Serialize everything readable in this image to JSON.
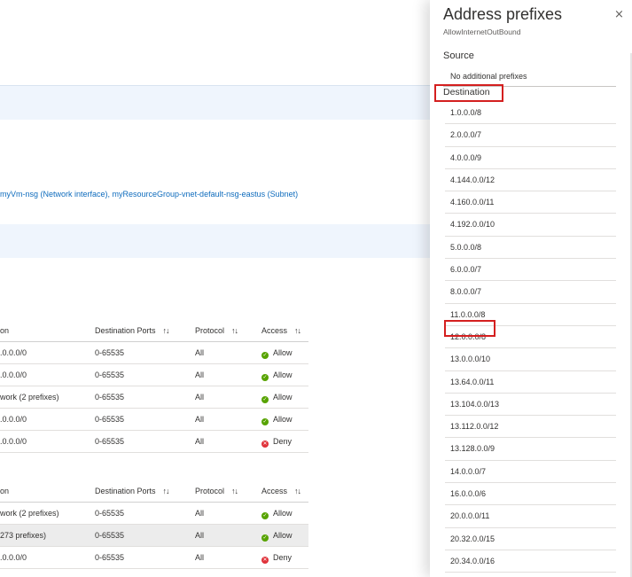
{
  "page": {
    "association_text": "myVm-nsg (Network interface), myResourceGroup-vnet-default-nsg-eastus (Subnet)"
  },
  "table1": {
    "headers": [
      "on",
      "Destination Ports",
      "Protocol",
      "Access"
    ],
    "rows": [
      {
        "dest": ".0.0.0/0",
        "ports": "0-65535",
        "protocol": "All",
        "access": "Allow"
      },
      {
        "dest": ".0.0.0/0",
        "ports": "0-65535",
        "protocol": "All",
        "access": "Allow"
      },
      {
        "dest": "work (2 prefixes)",
        "ports": "0-65535",
        "protocol": "All",
        "access": "Allow"
      },
      {
        "dest": ".0.0.0/0",
        "ports": "0-65535",
        "protocol": "All",
        "access": "Allow"
      },
      {
        "dest": ".0.0.0/0",
        "ports": "0-65535",
        "protocol": "All",
        "access": "Deny"
      }
    ]
  },
  "table2": {
    "headers": [
      "on",
      "Destination Ports",
      "Protocol",
      "Access"
    ],
    "rows": [
      {
        "dest": "work (2 prefixes)",
        "ports": "0-65535",
        "protocol": "All",
        "access": "Allow"
      },
      {
        "dest": "273 prefixes)",
        "ports": "0-65535",
        "protocol": "All",
        "access": "Allow"
      },
      {
        "dest": ".0.0.0/0",
        "ports": "0-65535",
        "protocol": "All",
        "access": "Deny"
      }
    ]
  },
  "panel": {
    "title": "Address prefixes",
    "subtitle": "AllowInternetOutBound",
    "close_icon": "×",
    "source_label": "Source",
    "source_value": "No additional prefixes",
    "destination_label": "Destination",
    "prefixes": [
      "1.0.0.0/8",
      "2.0.0.0/7",
      "4.0.0.0/9",
      "4.144.0.0/12",
      "4.160.0.0/11",
      "4.192.0.0/10",
      "5.0.0.0/8",
      "6.0.0.0/7",
      "8.0.0.0/7",
      "11.0.0.0/8",
      "12.0.0.0/8",
      "13.0.0.0/10",
      "13.64.0.0/11",
      "13.104.0.0/13",
      "13.112.0.0/12",
      "13.128.0.0/9",
      "14.0.0.0/7",
      "16.0.0.0/6",
      "20.0.0.0/11",
      "20.32.0.0/15",
      "20.34.0.0/16",
      "20.35.0.0/17"
    ]
  },
  "icons": {
    "sort": "sort-arrows-icon",
    "allow": "check-circle-icon",
    "deny": "x-circle-icon",
    "close": "close-icon"
  },
  "colors": {
    "allow": "#57a300",
    "deny": "#e0323a",
    "link": "#0f6cbd",
    "highlight": "#d41f1f",
    "band": "#eff5fd"
  }
}
